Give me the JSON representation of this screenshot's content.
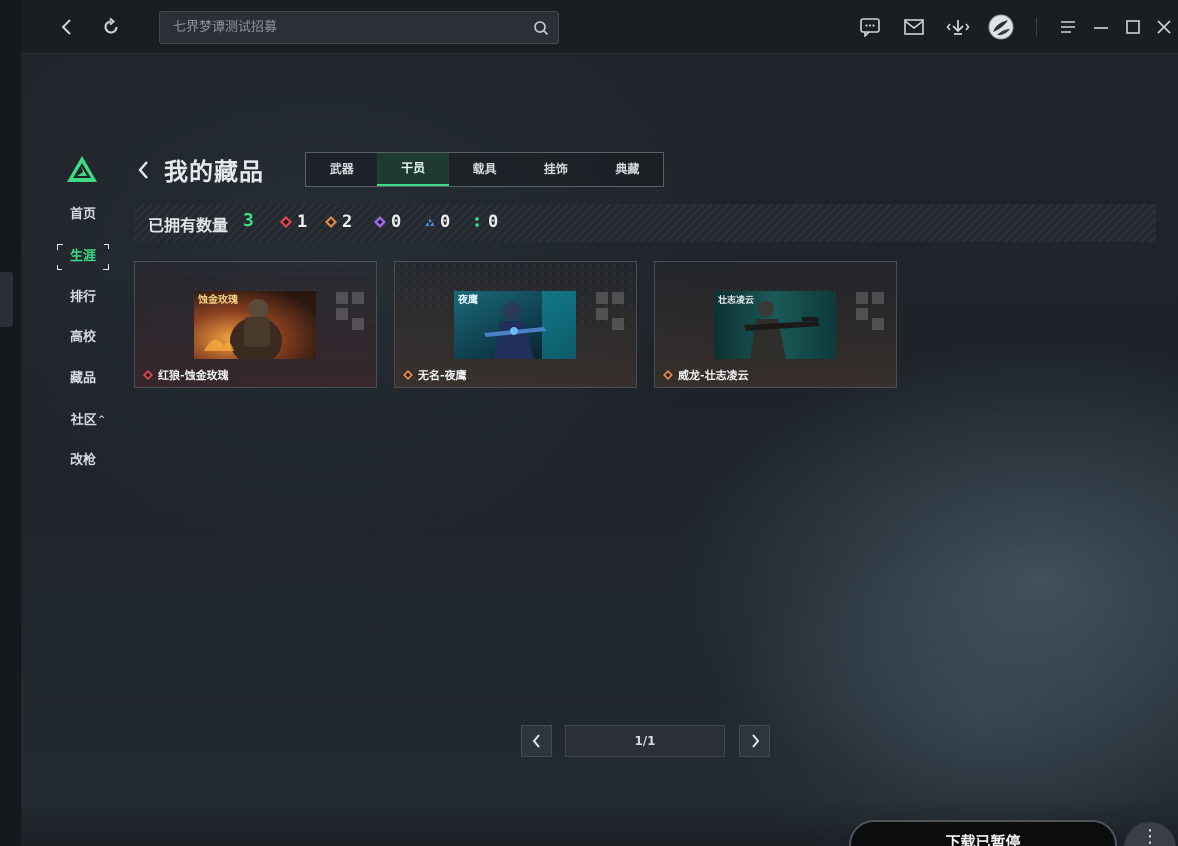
{
  "titlebar": {
    "search_placeholder": "七界梦谭测试招募",
    "icons": [
      "back-icon",
      "refresh-icon",
      "search-icon",
      "chat-icon",
      "mail-icon",
      "download-icon",
      "avatar",
      "menu-icon",
      "minimize-icon",
      "maximize-icon",
      "close-icon"
    ]
  },
  "sidebar": {
    "items": [
      {
        "label": "首页",
        "active": false
      },
      {
        "label": "生涯",
        "active": true
      },
      {
        "label": "排行",
        "active": false
      },
      {
        "label": "高校",
        "active": false
      },
      {
        "label": "藏品",
        "active": false
      },
      {
        "label": "社区",
        "active": false,
        "caret": "^"
      },
      {
        "label": "改枪",
        "active": false
      }
    ]
  },
  "header": {
    "title": "我的藏品",
    "tabs": [
      {
        "label": "武器",
        "active": false
      },
      {
        "label": "干员",
        "active": true
      },
      {
        "label": "载具",
        "active": false
      },
      {
        "label": "挂饰",
        "active": false
      },
      {
        "label": "典藏",
        "active": false
      }
    ]
  },
  "stats": {
    "owned_label": "已拥有数量",
    "owned_count": "3",
    "rarities": [
      {
        "color": "#e0484f",
        "count": "1"
      },
      {
        "color": "#e08a4a",
        "count": "2"
      },
      {
        "color": "#9a6ae0",
        "count": "0"
      },
      {
        "color": "#4a90e0",
        "count": "0"
      },
      {
        "color": "#3ddc84",
        "count": "0"
      }
    ]
  },
  "cards": [
    {
      "name": "红狼-蚀金玫瑰",
      "rarity_color": "#e0484f",
      "thumb_text": "蚀金玫瑰"
    },
    {
      "name": "无名-夜鹰",
      "rarity_color": "#e08a4a",
      "thumb_text": "夜鹰"
    },
    {
      "name": "威龙-壮志凌云",
      "rarity_color": "#e08a4a",
      "thumb_text": "壮志凌云"
    }
  ],
  "pagination": {
    "label": "1/1"
  },
  "bottom": {
    "download_label": "下载已暂停",
    "more_label": "⋮"
  }
}
